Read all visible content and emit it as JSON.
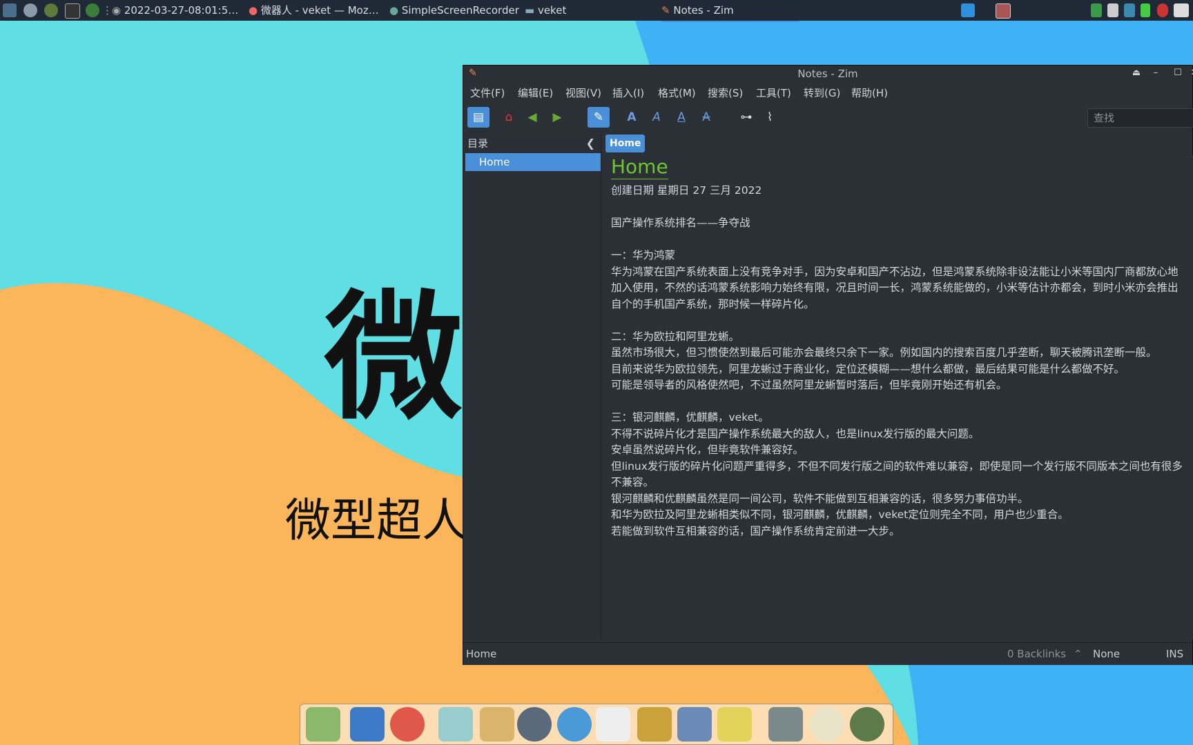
{
  "taskbar": {
    "items": [
      {
        "label": "2022-03-27-08:01:5…"
      },
      {
        "label": "微器人 - veket — Moz…"
      },
      {
        "label": "SimpleScreenRecorder"
      },
      {
        "label": "veket"
      },
      {
        "label": "Notes - Zim"
      }
    ]
  },
  "wallpaper": {
    "big_text": "微",
    "sub_text": "微型超人"
  },
  "window": {
    "title": "Notes - Zim",
    "menu": [
      "文件(F)",
      "编辑(E)",
      "视图(V)",
      "插入(I)",
      "格式(M)",
      "搜索(S)",
      "工具(T)",
      "转到(G)",
      "帮助(H)"
    ],
    "search_placeholder": "查找",
    "sidebar_header": "目录",
    "sidebar_items": [
      "Home"
    ],
    "breadcrumb": "Home",
    "page": {
      "title": "Home",
      "body": "创建日期 星期日 27 三月 2022\n\n国产操作系统排名——争夺战\n\n一：华为鸿蒙\n华为鸿蒙在国产系统表面上没有竞争对手，因为安卓和国产不沾边，但是鸿蒙系统除非设法能让小米等国内厂商都放心地\n加入使用，不然的话鸿蒙系统影响力始终有限，况且时间一长，鸿蒙系统能做的，小米等估计亦都会，到时小米亦会推出\n自个的手机国产系统，那时候一样碎片化。\n\n二：华为欧拉和阿里龙蜥。\n虽然市场很大，但习惯使然到最后可能亦会最终只余下一家。例如国内的搜索百度几乎垄断，聊天被腾讯垄断一般。\n目前来说华为欧拉领先，阿里龙蜥过于商业化，定位还模糊——想什么都做，最后结果可能是什么都做不好。\n可能是领导者的风格使然吧，不过虽然阿里龙蜥暂时落后，但毕竟刚开始还有机会。\n\n三：银河麒麟，优麒麟，veket。\n不得不说碎片化才是国产操作系统最大的敌人，也是linux发行版的最大问题。\n安卓虽然说碎片化，但毕竟软件兼容好。\n但linux发行版的碎片化问题严重得多，不但不同发行版之间的软件难以兼容，即使是同一个发行版不同版本之间也有很多\n不兼容。\n银河麒麟和优麒麟虽然是同一间公司，软件不能做到互相兼容的话，很多努力事倍功半。\n和华为欧拉及阿里龙蜥相类似不同，银河麒麟，优麒麟，veket定位则完全不同，用户也少重合。\n若能做到软件互相兼容的话，国产操作系统肯定前进一大步。"
    },
    "status": {
      "page": "Home",
      "backlinks": "0 Backlinks",
      "style": "None",
      "mode": "INS"
    }
  },
  "colors": {
    "accent": "#4a90d9",
    "title_green": "#6ec52e"
  }
}
